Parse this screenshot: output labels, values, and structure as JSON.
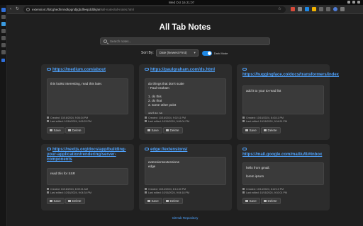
{
  "os": {
    "clock": "Wed Oct 16 21:07"
  },
  "browser": {
    "url_host": "extension://ldcghedhmndkpgndjlgbdfeepddbkjam",
    "url_path": "/all-notes/all-notes.html"
  },
  "page": {
    "title": "All Tab Notes",
    "search_placeholder": "Search notes...",
    "sort_label": "Sort By:",
    "sort_value": "Date (Newest First)",
    "dark_mode_label": "Dark Mode",
    "dark_mode_on": true,
    "footer_link": "GitHub Repository"
  },
  "buttons": {
    "save": "Save",
    "delete": "Delete"
  },
  "cards": [
    {
      "url": "https://medium.com/about",
      "note": "this looks interesting, read this later.",
      "created": "Created: 10/16/2024, 9:06:34 PM",
      "edited": "Last edited: 10/16/2024, 9:06:29 PM"
    },
    {
      "url": "https://paulgraham.com/ds.html",
      "note": "do things that don't scale\n- Paul Graham\n\n1. do this\n2. do that\n3. some other point\n\nand so on ...",
      "created": "Created: 10/16/2024, 9:02:11 PM",
      "edited": "Last edited: 10/16/2024, 9:06:04 PM"
    },
    {
      "url": "https://huggingface.co/docs/transformers/index",
      "note": "add it to your to-read list",
      "created": "Created: 10/16/2024, 8:43:11 PM",
      "edited": "Last edited: 10/16/2024, 9:04:51 PM"
    },
    {
      "url": "https://nextjs.org/docs/app/building-your-application/rendering/server-components",
      "note": "read this for SSR",
      "created": "Created: 10/16/2024, 8:39:21 AM",
      "edited": "Last edited: 10/16/2024, 9:04:34 PM"
    },
    {
      "url": "edge://extensions/",
      "note": "extensionsextensions\nedge",
      "created": "Created: 10/14/2024, 8:14:40 PM",
      "edited": "Last edited: 10/16/2024, 9:04:18 PM"
    },
    {
      "url": "https://mail.google.com/mail/u/0/#inbox",
      "note": "hello from gmail.\n\nlorem ipsum",
      "created": "Created: 10/14/2024, 8:22:10 PM",
      "edited": "Last edited: 10/16/2024, 9:02:01 PM"
    }
  ]
}
